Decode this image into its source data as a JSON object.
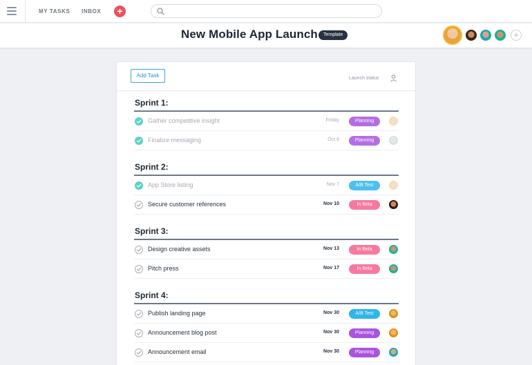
{
  "topbar": {
    "nav_my_tasks": "MY TASKS",
    "nav_inbox": "INBOX",
    "plus_label": "+"
  },
  "project": {
    "title": "New Mobile App Launch",
    "badge": "Template",
    "add_member_label": "+"
  },
  "toolbar": {
    "add_task_label": "Add Task",
    "column_label": "Launch status"
  },
  "colors": {
    "Planning": "#a955de",
    "A/B Test": "#2fb6ea",
    "In Beta": "#f8799e"
  },
  "sections": [
    {
      "title": "Sprint 1:",
      "tasks": [
        {
          "name": "Gather competitive insight",
          "date": "Friday",
          "status": "Planning",
          "done": true
        },
        {
          "name": "Finalize messaging",
          "date": "Oct 6",
          "status": "Planning",
          "done": true
        }
      ]
    },
    {
      "title": "Sprint 2:",
      "tasks": [
        {
          "name": "App Store listing",
          "date": "Nov 7",
          "status": "A/B Test",
          "done": true
        },
        {
          "name": "Secure customer references",
          "date": "Nov 10",
          "status": "In Beta",
          "done": false
        }
      ]
    },
    {
      "title": "Sprint 3:",
      "tasks": [
        {
          "name": "Design creative assets",
          "date": "Nov 13",
          "status": "In Beta",
          "done": false
        },
        {
          "name": "Pitch press",
          "date": "Nov 17",
          "status": "In Beta",
          "done": false
        }
      ]
    },
    {
      "title": "Sprint 4:",
      "tasks": [
        {
          "name": "Publish landing page",
          "date": "Nov 30",
          "status": "A/B Test",
          "done": false
        },
        {
          "name": "Announcement blog post",
          "date": "Nov 30",
          "status": "Planning",
          "done": false
        },
        {
          "name": "Announcement email",
          "date": "Nov 30",
          "status": "Planning",
          "done": false
        }
      ]
    }
  ]
}
